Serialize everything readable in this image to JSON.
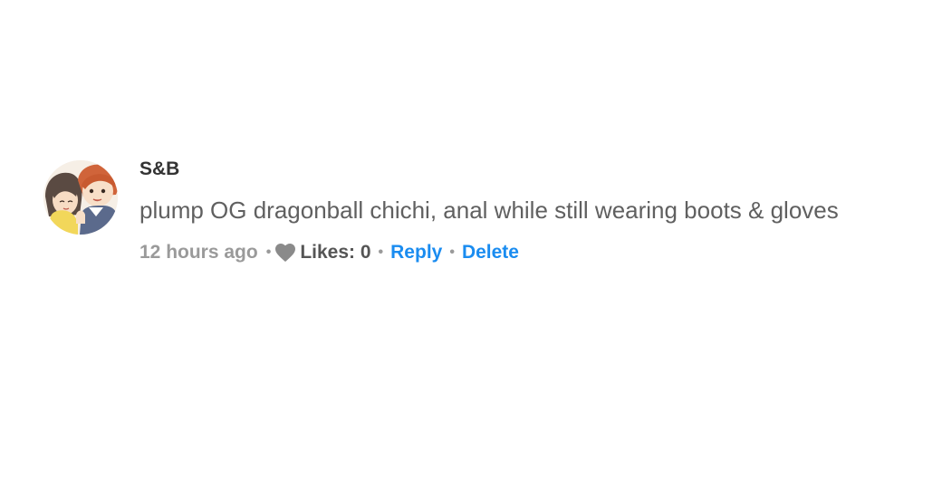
{
  "comment": {
    "avatar": {
      "icon": "user-avatar"
    },
    "username": "S&B",
    "text": "plump OG dragonball chichi, anal while still wearing boots & gloves",
    "meta": {
      "time": "12 hours ago",
      "separator": "•",
      "like_icon": "heart-icon",
      "likes_label": "Likes: 0",
      "reply_label": "Reply",
      "delete_label": "Delete"
    }
  },
  "colors": {
    "username": "#333333",
    "text": "#606060",
    "meta_gray": "#9a9a9a",
    "likes": "#555555",
    "link": "#1a8cf0",
    "heart": "#8a8a8a"
  }
}
